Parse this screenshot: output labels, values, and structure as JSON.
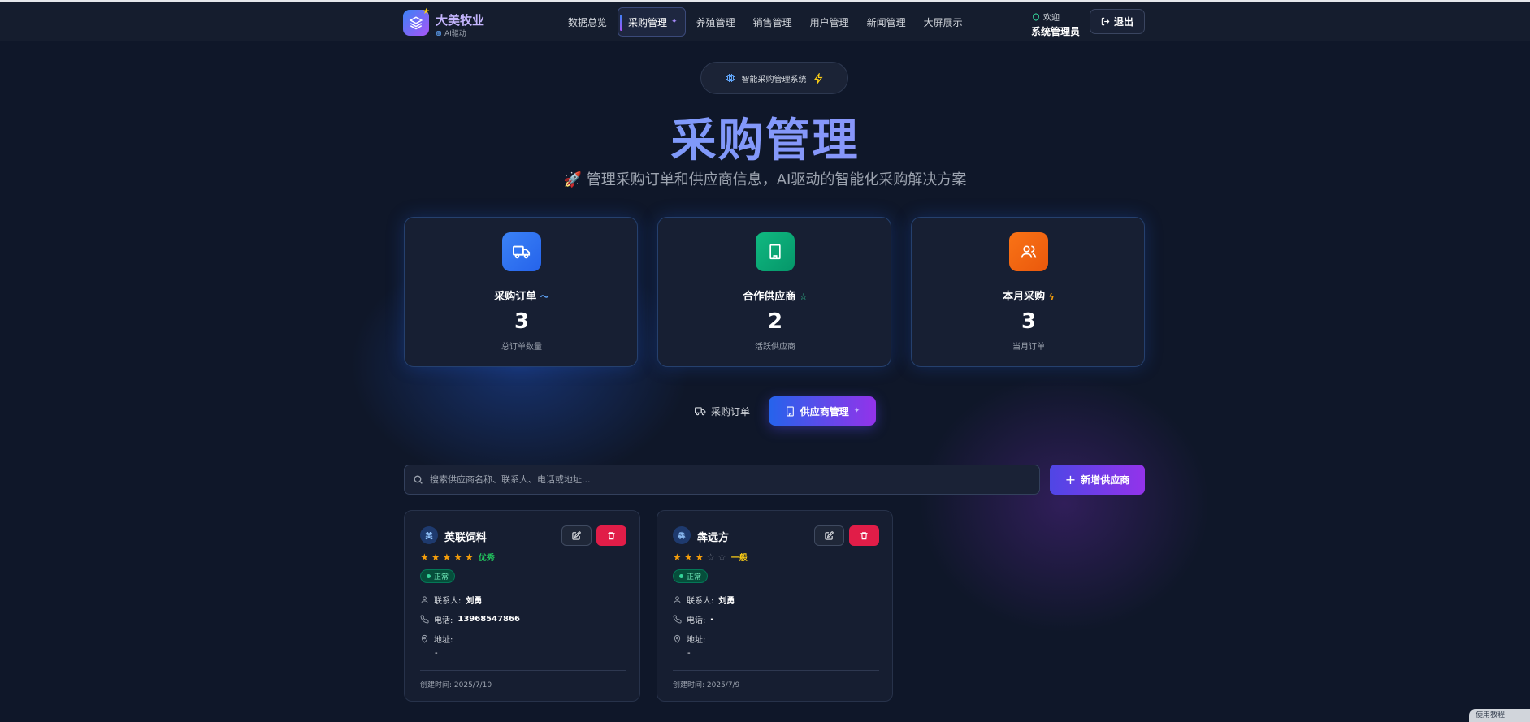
{
  "header": {
    "brand": "大美牧业",
    "brand_sub": "AI驱动",
    "nav": [
      "数据总览",
      "采购管理",
      "养殖管理",
      "销售管理",
      "用户管理",
      "新闻管理",
      "大屏展示"
    ],
    "active_nav": "采购管理",
    "welcome": "欢迎",
    "user": "系统管理员",
    "logout": "退出"
  },
  "hero": {
    "pill": "智能采购管理系统",
    "title": "采购管理",
    "subtitle": "🚀 管理采购订单和供应商信息，AI驱动的智能化采购解决方案"
  },
  "stats": [
    {
      "label": "采购订单",
      "value": "3",
      "desc": "总订单数量",
      "icon": "truck-icon",
      "color": "#3b82f6"
    },
    {
      "label": "合作供应商",
      "value": "2",
      "desc": "活跃供应商",
      "icon": "building-icon",
      "color": "#10b981"
    },
    {
      "label": "本月采购",
      "value": "3",
      "desc": "当月订单",
      "icon": "users-icon",
      "color": "#f97316"
    }
  ],
  "tabs": {
    "orders": "采购订单",
    "suppliers": "供应商管理"
  },
  "search": {
    "placeholder": "搜索供应商名称、联系人、电话或地址..."
  },
  "add_button": "新增供应商",
  "labels": {
    "contact": "联系人:",
    "phone": "电话:",
    "address": "地址:"
  },
  "suppliers": [
    {
      "avatar": "英",
      "name": "英联饲料",
      "rating": 5,
      "rating_text": "优秀",
      "rating_color": "#22c55e",
      "status": "正常",
      "contact": "刘勇",
      "phone": "13968547866",
      "address": "-",
      "created": "创建时间: 2025/7/10"
    },
    {
      "avatar": "犇",
      "name": "犇远方",
      "rating": 3,
      "rating_text": "一般",
      "rating_color": "#facc15",
      "status": "正常",
      "contact": "刘勇",
      "phone": "-",
      "address": "-",
      "created": "创建时间: 2025/7/9"
    }
  ],
  "corner_badge": "使用教程"
}
